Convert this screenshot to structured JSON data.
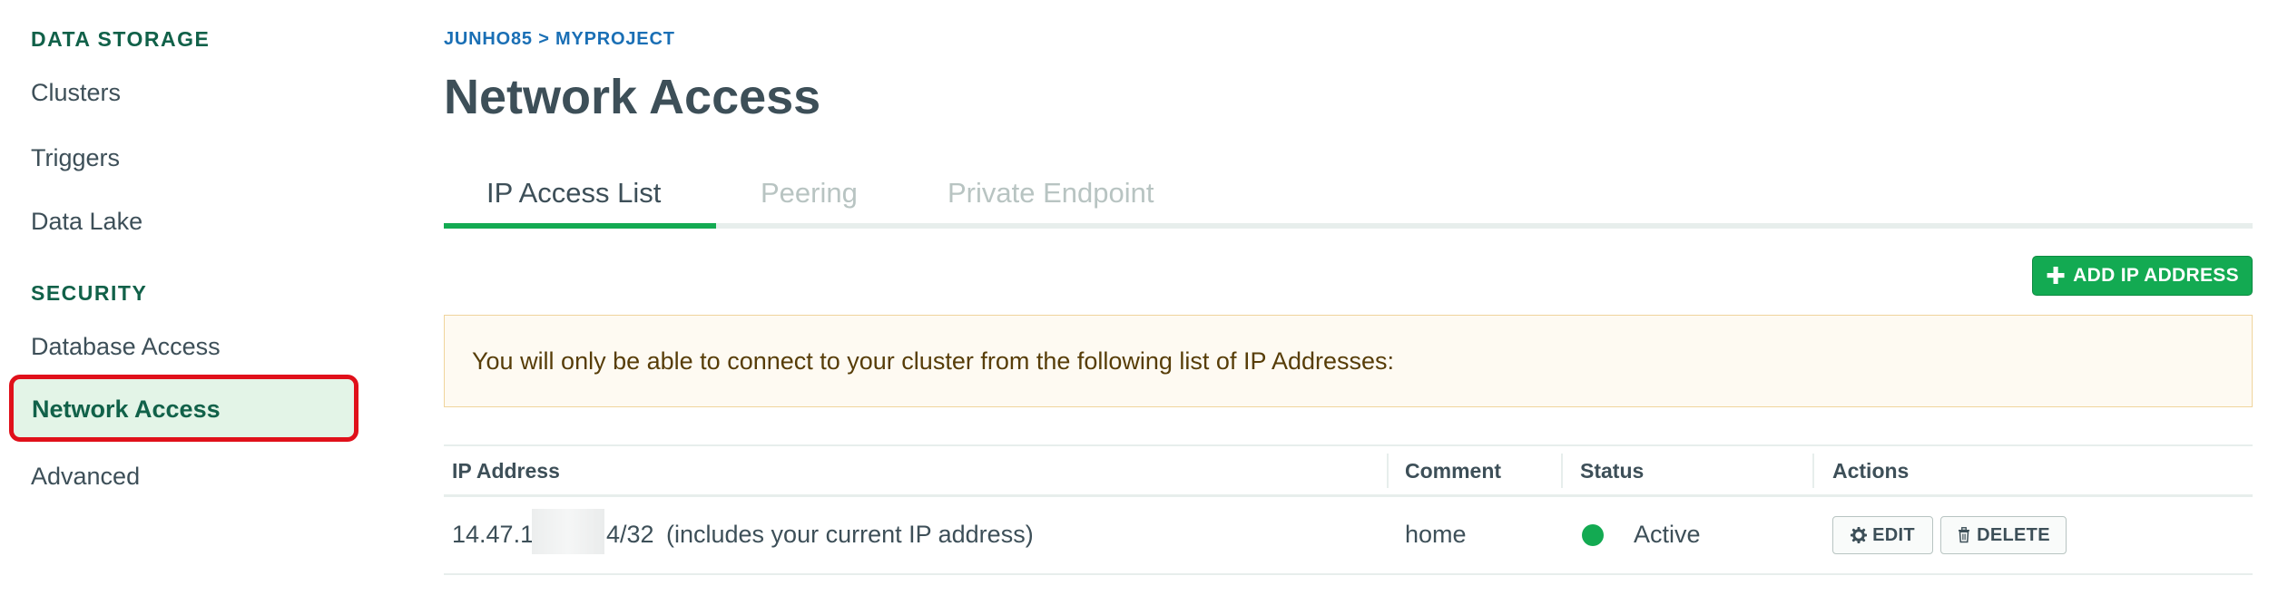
{
  "sidebar": {
    "data_storage_heading": "DATA STORAGE",
    "data_storage_items": [
      "Clusters",
      "Triggers",
      "Data Lake"
    ],
    "security_heading": "SECURITY",
    "security_items": [
      "Database Access",
      "Network Access",
      "Advanced"
    ],
    "active_item": "Network Access"
  },
  "breadcrumb": "JUNHO85 > MYPROJECT",
  "page_title": "Network Access",
  "tabs": [
    {
      "label": "IP Access List",
      "active": true
    },
    {
      "label": "Peering",
      "active": false
    },
    {
      "label": "Private Endpoint",
      "active": false
    }
  ],
  "add_button": {
    "label": "ADD IP ADDRESS",
    "icon": "plus-icon"
  },
  "notice": "You will only be able to connect to your cluster from the following list of IP Addresses:",
  "table": {
    "columns": [
      "IP Address",
      "Comment",
      "Status",
      "Actions"
    ],
    "rows": [
      {
        "ip_prefix": "14.47.1",
        "ip_suffix": "4/32",
        "ip_note": "(includes your current IP address)",
        "comment": "home",
        "status": "Active",
        "edit_label": "EDIT",
        "delete_label": "DELETE"
      }
    ]
  },
  "colors": {
    "accent_green": "#13aa52",
    "heading_green": "#116149",
    "link_blue": "#1a6fb5",
    "highlight_red": "#e0101a",
    "notice_bg": "#fefaf2"
  }
}
